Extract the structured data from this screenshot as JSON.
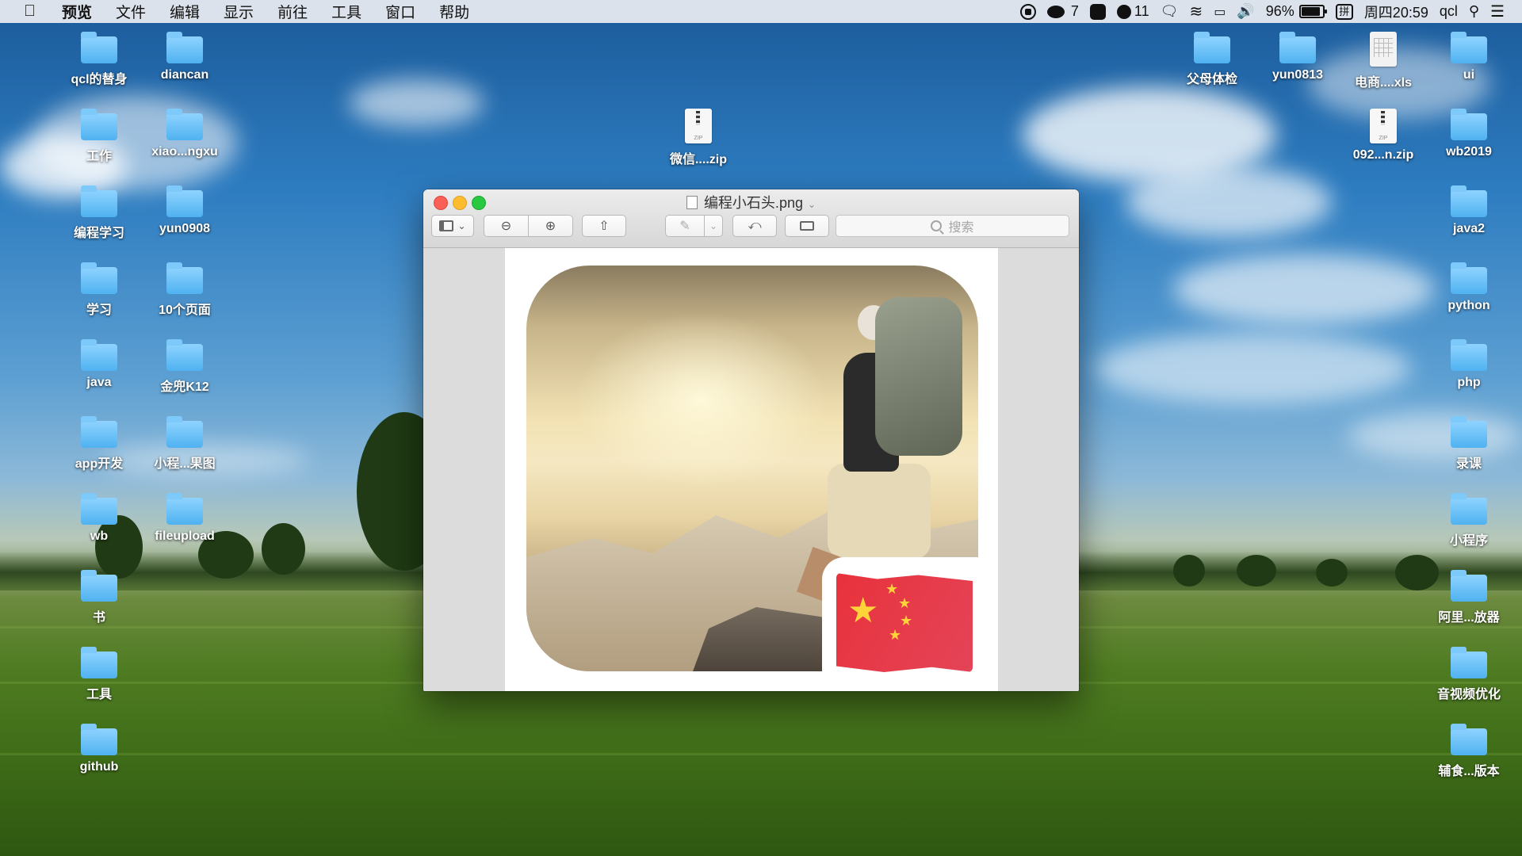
{
  "menubar": {
    "app": "预览",
    "items": [
      "文件",
      "编辑",
      "显示",
      "前往",
      "工具",
      "窗口",
      "帮助"
    ],
    "status": {
      "wechat_count": "7",
      "notify_count": "11",
      "battery": "96%",
      "ime": "拼",
      "clock": "周四20:59",
      "user": "qcl"
    }
  },
  "desktop": {
    "left_col1": [
      "qcl的替身",
      "工作",
      "编程学习",
      "学习",
      "java",
      "app开发",
      "wb",
      "书",
      "工具",
      "github"
    ],
    "left_col2": [
      "diancan",
      "xiao...ngxu",
      "yun0908",
      "10个页面",
      "金兜K12",
      "小程...果图",
      "fileupload"
    ],
    "middle_zip": "微信....zip",
    "right_col1": [
      "父母体检",
      "yun0813",
      "电商....xls",
      "092...n.zip"
    ],
    "right_col2": [
      "ui",
      "wb2019",
      "java2",
      "python",
      "php",
      "录课",
      "小程序",
      "阿里...放器",
      "音视频优化",
      "辅食...版本"
    ]
  },
  "window": {
    "title": "编程小石头.png",
    "search_placeholder": "搜索"
  },
  "colors": {
    "close": "#fc5f57",
    "minimize": "#fdbc2e",
    "maximize": "#28c840",
    "folder": "#5ab8f2",
    "flag_red": "#e8323c",
    "flag_star": "#ffd43b"
  }
}
